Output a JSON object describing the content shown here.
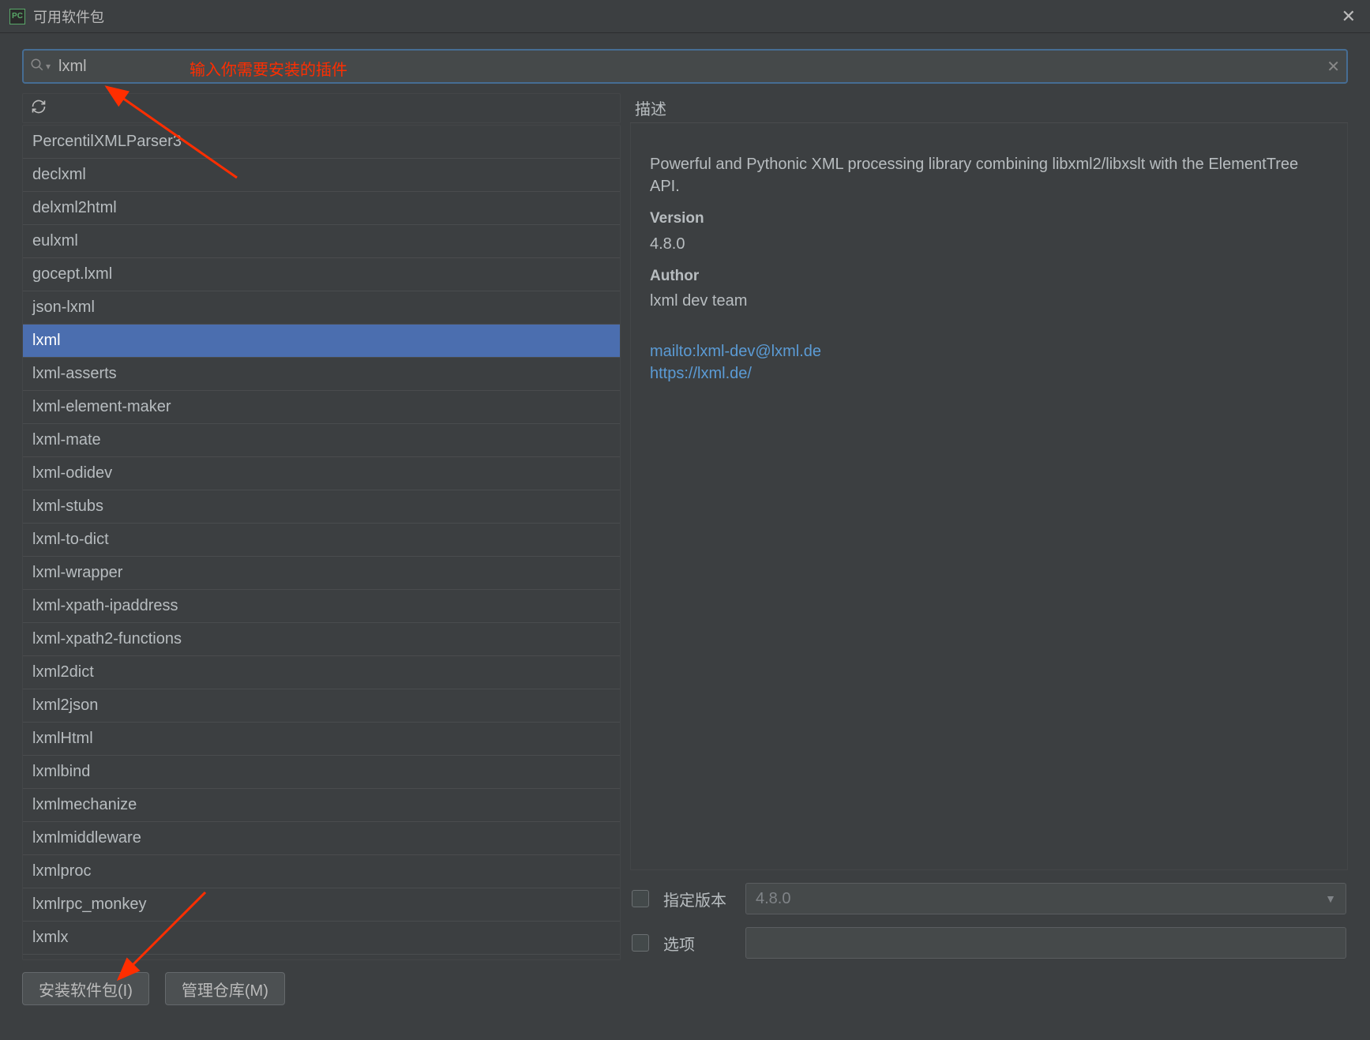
{
  "window": {
    "title": "可用软件包"
  },
  "search": {
    "value": "lxml"
  },
  "annotation": {
    "text": "输入你需要安装的插件"
  },
  "packages": {
    "items": [
      "PercentilXMLParser3",
      "declxml",
      "delxml2html",
      "eulxml",
      "gocept.lxml",
      "json-lxml",
      "lxml",
      "lxml-asserts",
      "lxml-element-maker",
      "lxml-mate",
      "lxml-odidev",
      "lxml-stubs",
      "lxml-to-dict",
      "lxml-wrapper",
      "lxml-xpath-ipaddress",
      "lxml-xpath2-functions",
      "lxml2dict",
      "lxml2json",
      "lxmlHtml",
      "lxmlbind",
      "lxmlmechanize",
      "lxmlmiddleware",
      "lxmlproc",
      "lxmlrpc_monkey",
      "lxmlx"
    ],
    "selected_index": 6
  },
  "details": {
    "header": "描述",
    "description": "Powerful and Pythonic XML processing library combining libxml2/libxslt with the ElementTree API.",
    "version_label": "Version",
    "version_value": "4.8.0",
    "author_label": "Author",
    "author_value": "lxml dev team",
    "links": [
      "mailto:lxml-dev@lxml.de",
      "https://lxml.de/"
    ]
  },
  "options": {
    "specify_version_label": "指定版本",
    "specify_version_value": "4.8.0",
    "options_label": "选项",
    "options_value": ""
  },
  "footer": {
    "install_label": "安装软件包(I)",
    "manage_label": "管理仓库(M)"
  }
}
